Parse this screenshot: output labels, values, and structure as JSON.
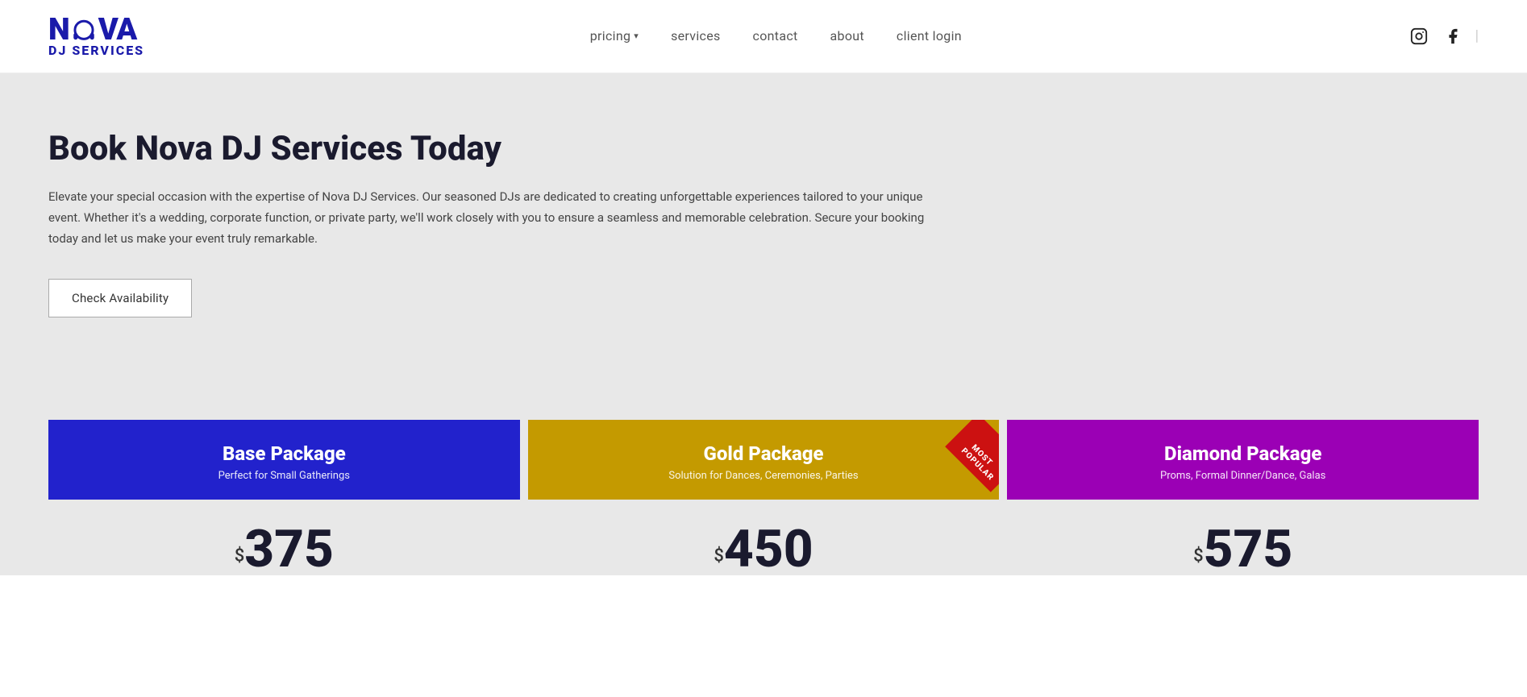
{
  "header": {
    "logo": {
      "main": "NOVA",
      "subtitle": "DJ SERVICES"
    },
    "nav": {
      "items": [
        {
          "label": "pricing",
          "href": "#",
          "hasDropdown": true
        },
        {
          "label": "services",
          "href": "#"
        },
        {
          "label": "contact",
          "href": "#"
        },
        {
          "label": "about",
          "href": "#"
        },
        {
          "label": "client login",
          "href": "#"
        }
      ]
    },
    "social": {
      "instagram_label": "Instagram",
      "facebook_label": "Facebook"
    }
  },
  "hero": {
    "title": "Book Nova DJ Services Today",
    "description": "Elevate your special occasion with the expertise of Nova DJ Services. Our seasoned DJs are dedicated to creating unforgettable experiences tailored to your unique event. Whether it's a wedding, corporate function, or private party, we'll work closely with you to ensure a seamless and memorable celebration. Secure your booking today and let us make your event truly remarkable.",
    "cta_label": "Check Availability"
  },
  "packages": [
    {
      "id": "base",
      "name": "Base Package",
      "subtitle": "Perfect for Small Gatherings",
      "price": "375",
      "most_popular": false,
      "color_class": "base"
    },
    {
      "id": "gold",
      "name": "Gold Package",
      "subtitle": "Solution for Dances, Ceremonies, Parties",
      "price": "450",
      "most_popular": true,
      "color_class": "gold"
    },
    {
      "id": "diamond",
      "name": "Diamond Package",
      "subtitle": "Proms, Formal Dinner/Dance, Galas",
      "price": "575",
      "most_popular": false,
      "color_class": "diamond"
    }
  ],
  "badge": {
    "most_popular": "MOST POPULAR"
  }
}
